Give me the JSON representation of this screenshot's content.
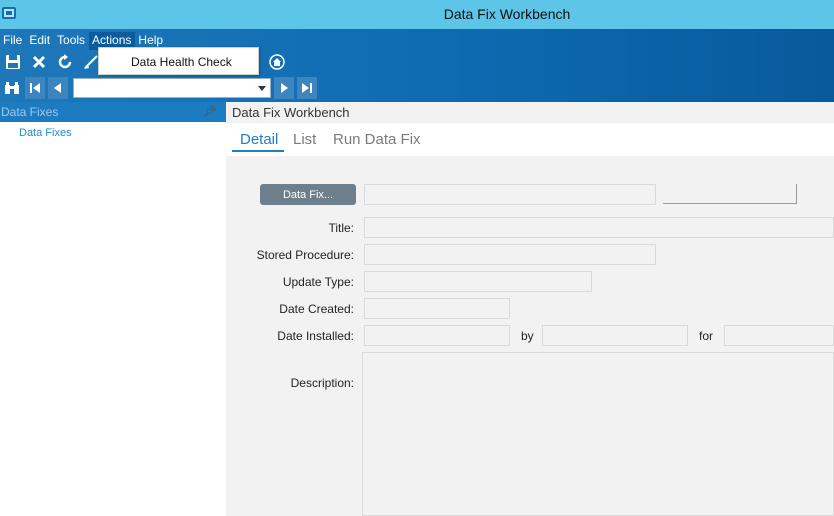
{
  "window": {
    "title": "Data Fix Workbench"
  },
  "menu": {
    "items": [
      "File",
      "Edit",
      "Tools",
      "Actions",
      "Help"
    ],
    "active": "Actions"
  },
  "dropdown": {
    "items": [
      "Data Health Check"
    ]
  },
  "toolbar": {
    "icons": [
      "save-icon",
      "delete-icon",
      "refresh-icon",
      "clear-icon",
      "home-icon"
    ],
    "nav_icons": [
      "binoculars-icon",
      "first-record-icon",
      "previous-record-icon",
      "next-record-icon",
      "last-record-icon"
    ],
    "combo_value": ""
  },
  "left_panel": {
    "header": "Data Fixes",
    "items": [
      "Data Fixes"
    ]
  },
  "content": {
    "header": "Data Fix Workbench",
    "tabs": [
      "Detail",
      "List",
      "Run Data Fix"
    ],
    "active_tab": "Detail"
  },
  "form": {
    "data_fix_button": "Data Fix...",
    "title_label": "Title:",
    "stored_procedure_label": "Stored Procedure:",
    "update_type_label": "Update Type:",
    "date_created_label": "Date Created:",
    "date_installed_label": "Date Installed:",
    "by_label": "by",
    "for_label": "for",
    "description_label": "Description:"
  },
  "colors": {
    "titlebar": "#5cc5e8",
    "ribbon": "#0f6cb3",
    "accent": "#1a7fc4"
  }
}
